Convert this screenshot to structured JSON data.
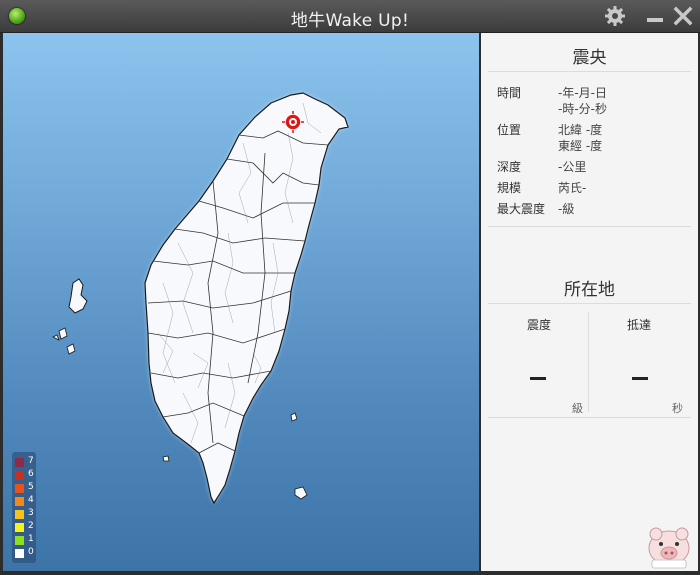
{
  "window": {
    "title": "地牛Wake Up!"
  },
  "titlebar": {
    "settings_icon": "gear-icon",
    "minimize_icon": "minimize-icon",
    "close_icon": "close-icon"
  },
  "colors": {
    "status_dot": "#4fa41a",
    "epicenter_marker": "#e01515"
  },
  "legend": {
    "items": [
      {
        "level": "7",
        "color": "#8e2a4a"
      },
      {
        "level": "6",
        "color": "#c8301e"
      },
      {
        "level": "5",
        "color": "#e8521c"
      },
      {
        "level": "4",
        "color": "#f08a1c"
      },
      {
        "level": "3",
        "color": "#f6c31c"
      },
      {
        "level": "2",
        "color": "#f6f21c"
      },
      {
        "level": "1",
        "color": "#8fe01c"
      },
      {
        "level": "0",
        "color": "#ffffff"
      }
    ]
  },
  "epicenter": {
    "title": "震央",
    "time_label": "時間",
    "date_value": "-年-月-日",
    "time_value": "-時-分-秒",
    "location_label": "位置",
    "lat_value": "北緯 -度",
    "lon_value": "東經 -度",
    "depth_label": "深度",
    "depth_value": "-公里",
    "magnitude_label": "規模",
    "magnitude_value": "芮氏-",
    "max_intensity_label": "最大震度",
    "max_intensity_value": "-級"
  },
  "local": {
    "title": "所在地",
    "intensity_label": "震度",
    "intensity_unit": "級",
    "arrival_label": "抵達",
    "arrival_unit": "秒"
  }
}
